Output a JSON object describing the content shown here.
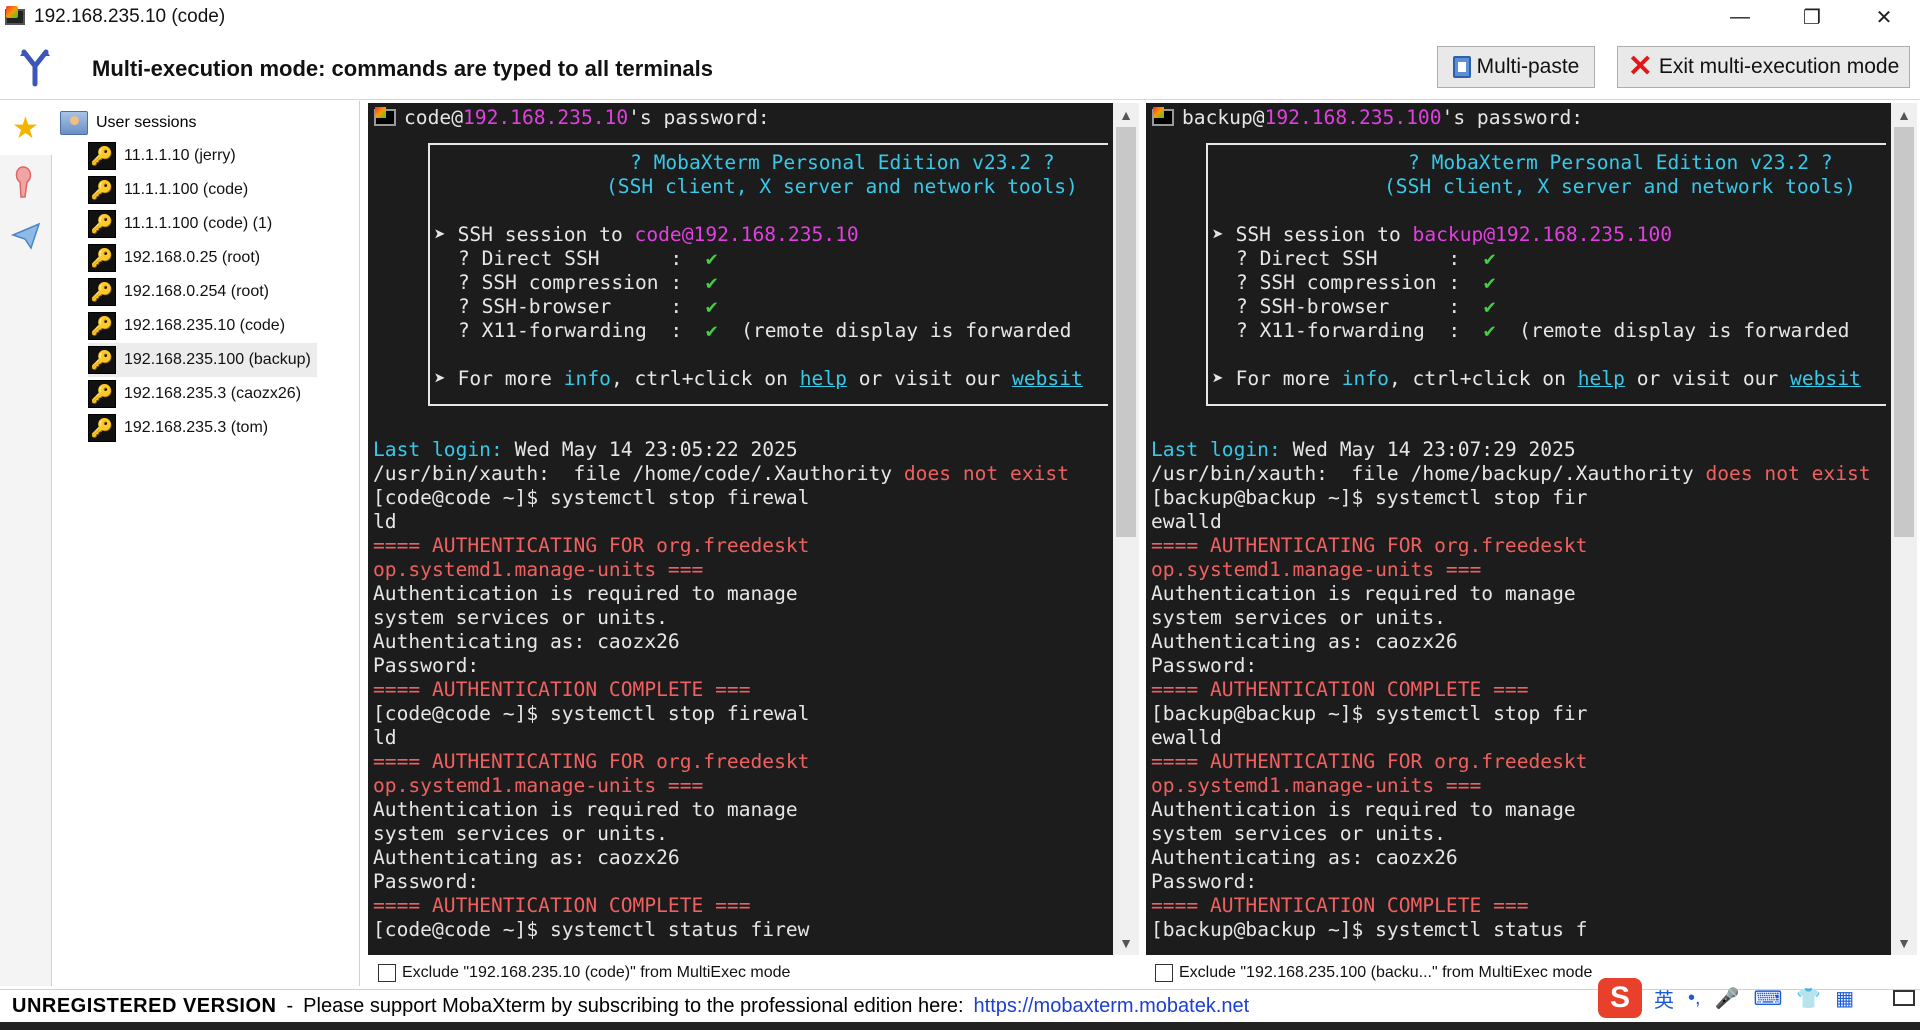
{
  "window": {
    "title": "192.168.235.10 (code)",
    "minimize": "—",
    "maximize": "❐",
    "close": "✕"
  },
  "multiexec": {
    "title": "Multi-execution mode: commands are typed to all terminals",
    "multipaste_label": "Multi-paste",
    "exit_label": "Exit multi-execution mode"
  },
  "rail": {
    "items": [
      "star-icon",
      "tools-icon",
      "send-icon"
    ]
  },
  "sessions": {
    "root_label": "User sessions",
    "items": [
      {
        "label": "11.1.1.10 (jerry)"
      },
      {
        "label": "11.1.1.100 (code)"
      },
      {
        "label": "11.1.1.100 (code) (1)"
      },
      {
        "label": "192.168.0.25 (root)"
      },
      {
        "label": "192.168.0.254 (root)"
      },
      {
        "label": "192.168.235.10 (code)"
      },
      {
        "label": "192.168.235.100 (backup)",
        "selected": true
      },
      {
        "label": "192.168.235.3 (caozx26)"
      },
      {
        "label": "192.168.235.3 (tom)"
      }
    ]
  },
  "terminals": [
    {
      "user": "code",
      "host": "192.168.235.10",
      "login_time": "Wed May 14 23:05:22 2025",
      "home": "/home/code/.Xauthority",
      "prompt": "[code@code ~]$",
      "cmd1_a": "systemctl stop firewal",
      "cmd1_b": "ld",
      "cmd_last": "systemctl status firew",
      "exclude_label": "Exclude \"192.168.235.10 (code)\" from MultiExec mode"
    },
    {
      "user": "backup",
      "host": "192.168.235.100",
      "login_time": "Wed May 14 23:07:29 2025",
      "home": "/home/backup/.Xauthority",
      "prompt": "[backup@backup ~]$",
      "cmd1_a": "systemctl stop fir",
      "cmd1_b": "ewalld",
      "cmd_last": "systemctl status f",
      "exclude_label": "Exclude \"192.168.235.100 (backu...\" from MultiExec mode"
    }
  ],
  "banner": {
    "line1": "? MobaXterm Personal Edition v23.2 ?",
    "line2": "(SSH client, X server and network tools)",
    "ssh_to": "SSH session to",
    "direct_ssh": "? Direct SSH      :",
    "compression": "? SSH compression :",
    "browser": "? SSH-browser     :",
    "x11": "? X11-forwarding  :",
    "check": "✔",
    "x11_note": "(remote display is forwarded",
    "more_pre": "For more",
    "more_info": "info",
    "more_mid": ", ctrl+click on",
    "more_help": "help",
    "more_or": "or visit our",
    "more_site": "websit",
    "bullet": "➤"
  },
  "output": {
    "password_suffix": "'s password:",
    "last_login": "Last login:",
    "xauth": "/usr/bin/xauth:  file",
    "not_exist": "does not exist",
    "auth_for_a": "==== AUTHENTICATING FOR org.freedeskt",
    "auth_for_b": "op.systemd1.manage-units ===",
    "auth_req_a": "Authentication is required to manage",
    "auth_req_b": "system services or units.",
    "auth_as": "Authenticating as: caozx26",
    "password": "Password:",
    "auth_done": "==== AUTHENTICATION COMPLETE ==="
  },
  "status": {
    "unregistered": "UNREGISTERED VERSION",
    "sep": "-",
    "message": "Please support MobaXterm by subscribing to the professional edition here:",
    "link": "https://mobaxterm.mobatek.net"
  },
  "ime": {
    "logo": "S",
    "lang": "英",
    "punct": "•,",
    "mic": "🎤",
    "kbd": "⌨",
    "skin": "👕",
    "grid": "▦"
  },
  "colors": {
    "terminal_bg": "#1c1c1c",
    "magenta": "#e040e0",
    "cyan": "#38c8e8",
    "red": "#f06060",
    "green": "#40d040",
    "link": "#1a3fd4"
  }
}
